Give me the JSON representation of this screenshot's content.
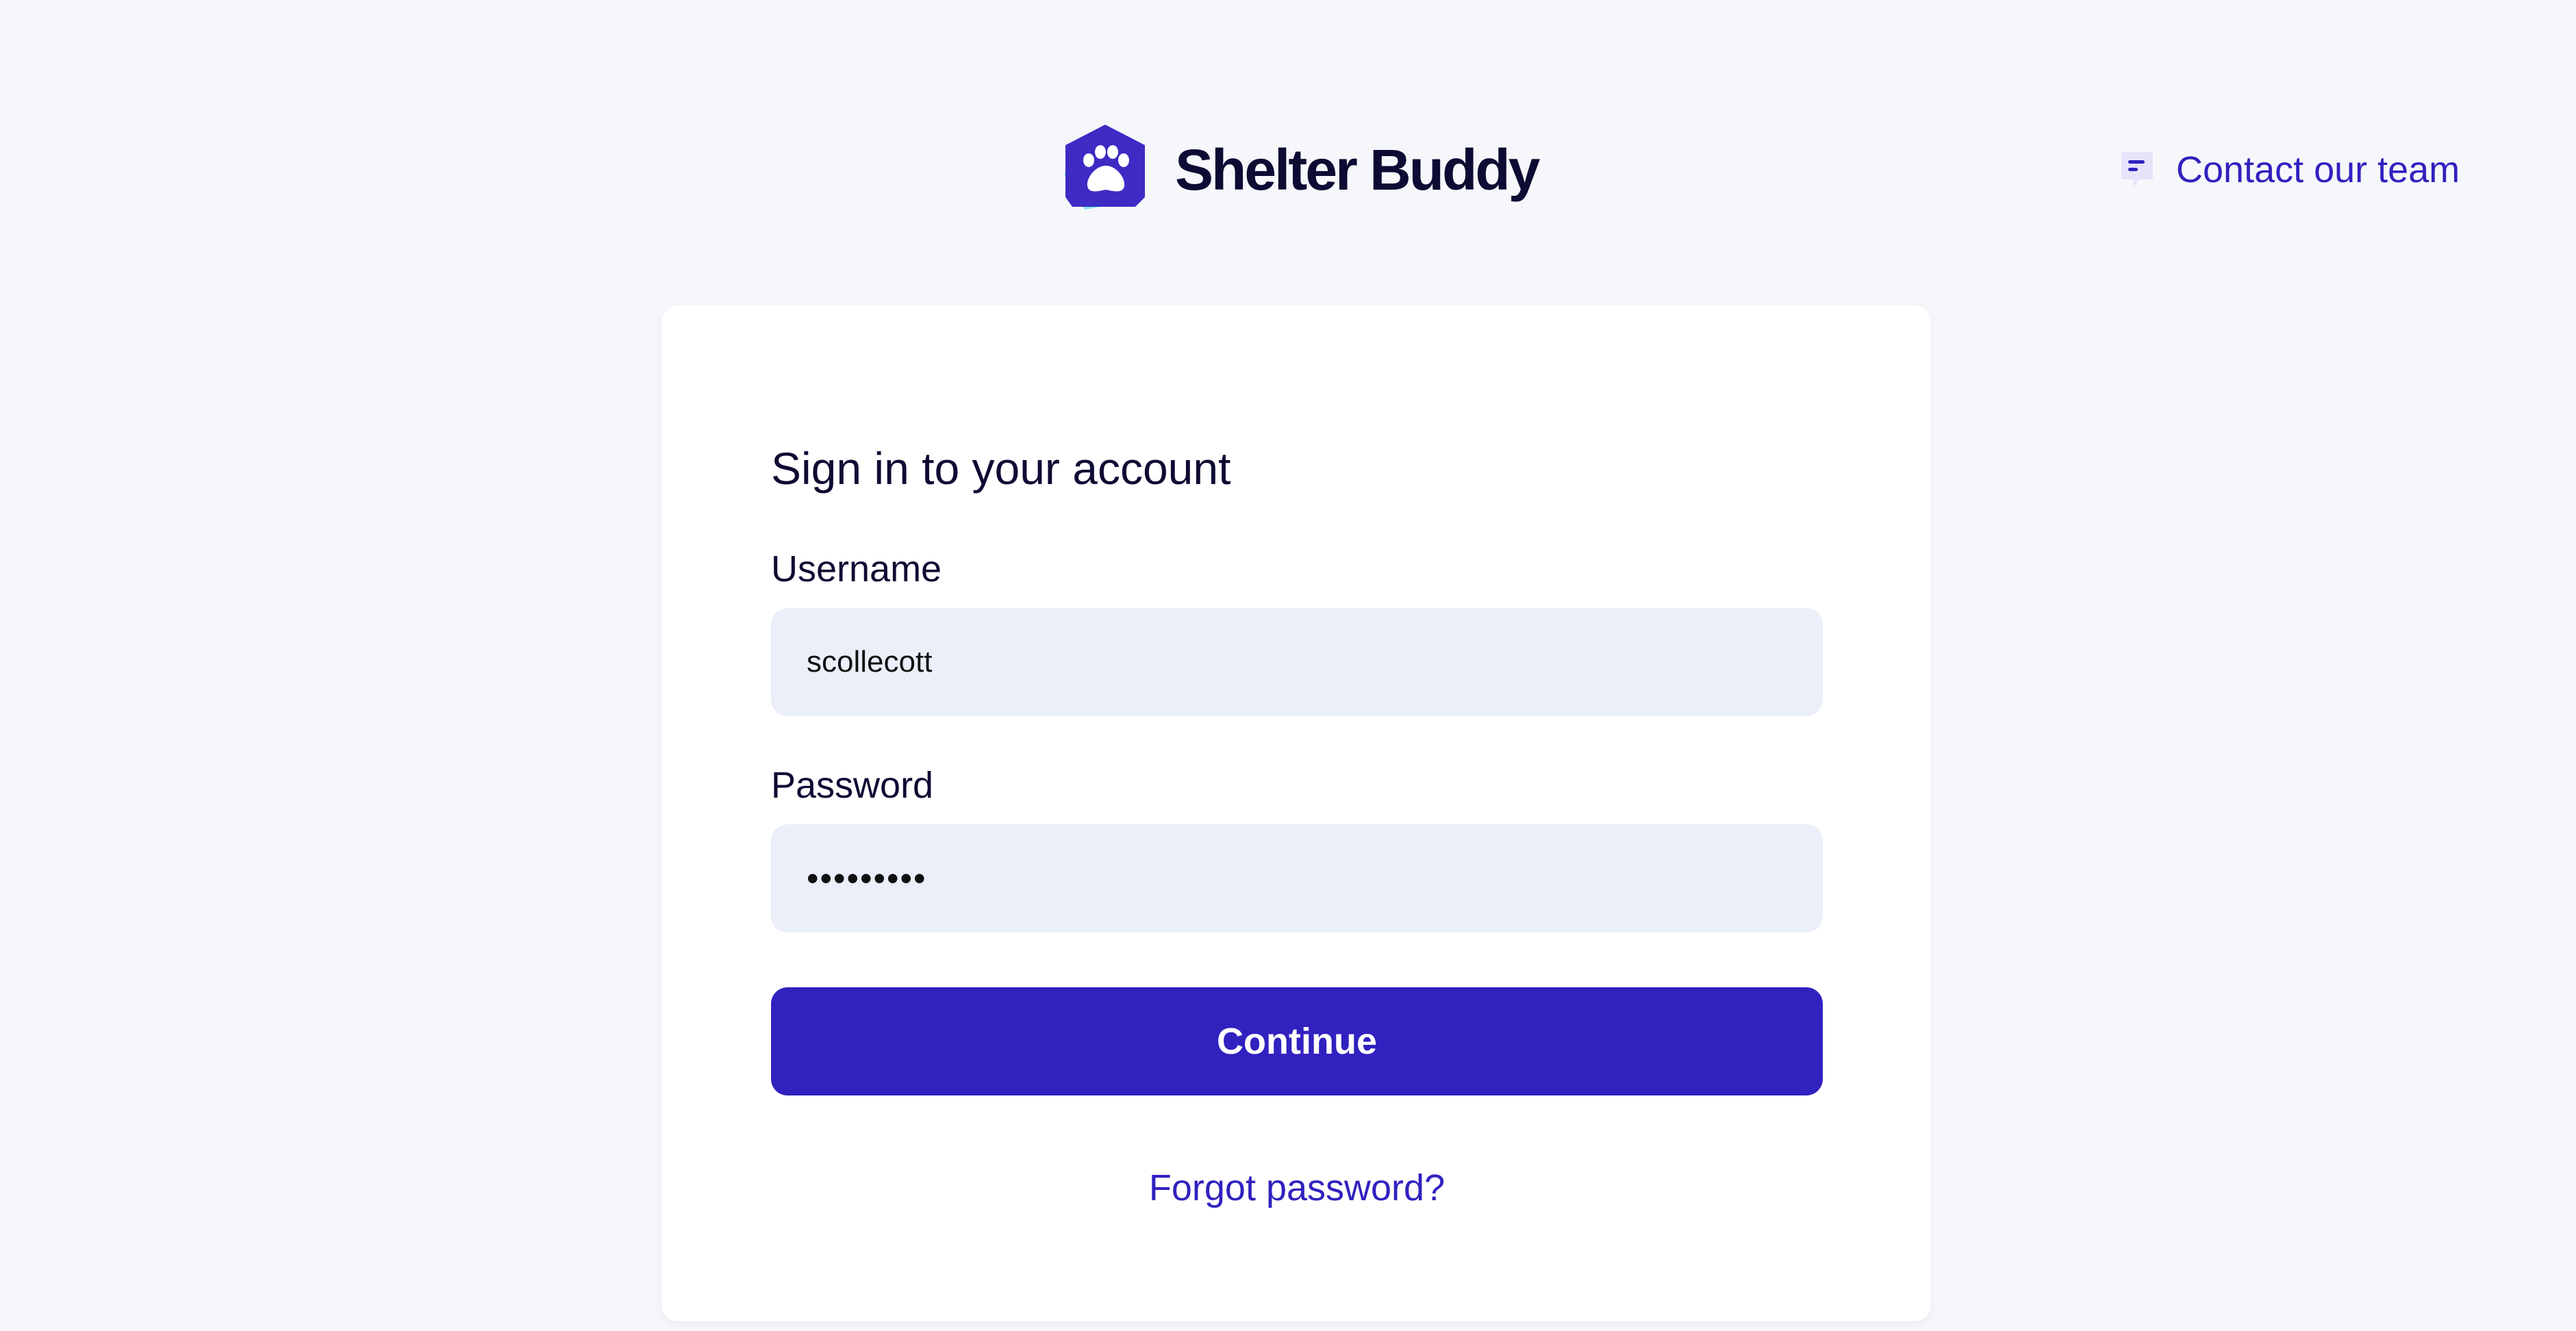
{
  "brand": {
    "name": "Shelter Buddy",
    "logo_icon": "paw-icon",
    "colors": {
      "hex_front": "#3d2bc4",
      "hex_middle": "#8a7cef",
      "hex_back": "#7fe2ef"
    }
  },
  "header": {
    "contact_label": "Contact our team",
    "contact_icon": "chat-bubble-icon"
  },
  "form": {
    "title": "Sign in to your account",
    "username_label": "Username",
    "username_value": "scollecott",
    "password_label": "Password",
    "password_value": "•••••••••",
    "continue_label": "Continue",
    "forgot_label": "Forgot password?"
  },
  "colors": {
    "page_background": "#f6f7fb",
    "card_background": "#ffffff",
    "input_background": "#ebeffa",
    "accent": "#3121bf",
    "text": "#0d0b33"
  }
}
